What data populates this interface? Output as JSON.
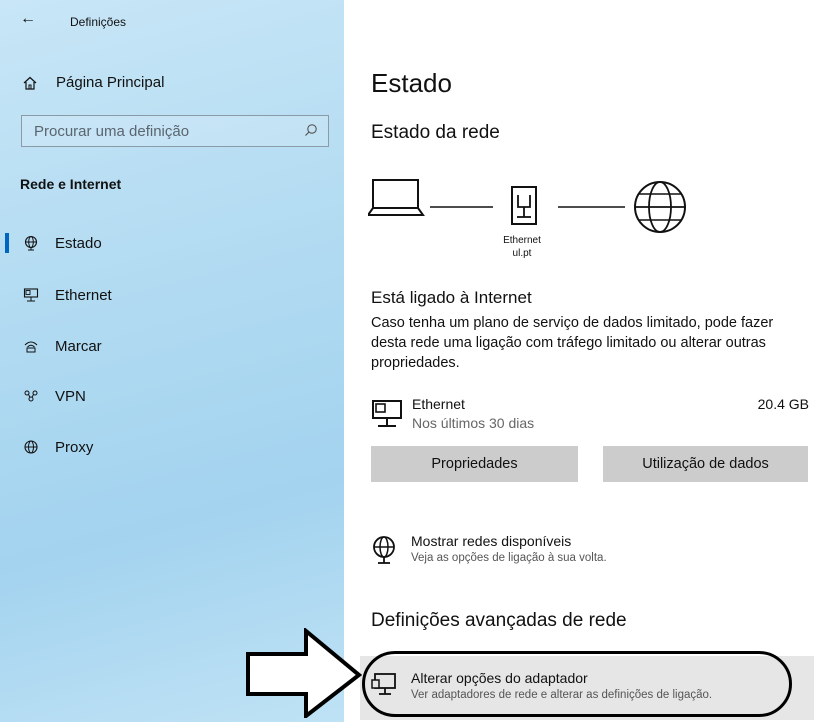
{
  "window": {
    "title": "Definições",
    "back_icon": "back-arrow-icon"
  },
  "sidebar": {
    "home": {
      "label": "Página Principal",
      "icon": "home-icon"
    },
    "search": {
      "placeholder": "Procurar uma definição",
      "icon": "search-icon"
    },
    "section_title": "Rede e Internet",
    "items": [
      {
        "label": "Estado",
        "icon": "globe-status-icon",
        "active": true
      },
      {
        "label": "Ethernet",
        "icon": "ethernet-icon",
        "active": false
      },
      {
        "label": "Marcar",
        "icon": "dialup-icon",
        "active": false
      },
      {
        "label": "VPN",
        "icon": "vpn-icon",
        "active": false
      },
      {
        "label": "Proxy",
        "icon": "globe-icon",
        "active": false
      }
    ]
  },
  "main": {
    "title": "Estado",
    "network_status_heading": "Estado da rede",
    "diagram": {
      "device_line1": "Ethernet",
      "device_line2": "ul.pt"
    },
    "connection_title": "Está ligado à Internet",
    "connection_desc": "Caso tenha um plano de serviço de dados limitado, pode fazer desta rede uma ligação com tráfego limitado ou alterar outras propriedades.",
    "ethernet": {
      "name": "Ethernet",
      "sub": "Nos últimos 30 dias",
      "usage": "20.4 GB"
    },
    "buttons": {
      "properties": "Propriedades",
      "data_usage": "Utilização de dados"
    },
    "show_networks": {
      "title": "Mostrar redes disponíveis",
      "sub": "Veja as opções de ligação à sua volta."
    },
    "advanced_heading": "Definições avançadas de rede",
    "adapter": {
      "title": "Alterar opções do adaptador",
      "sub": "Ver adaptadores de rede e alterar as definições de ligação."
    }
  },
  "colors": {
    "accent": "#0067c0",
    "sidebar_bg": "#b4dcf2",
    "button_bg": "#cccccc",
    "highlight_bg": "#e6e6e6"
  }
}
